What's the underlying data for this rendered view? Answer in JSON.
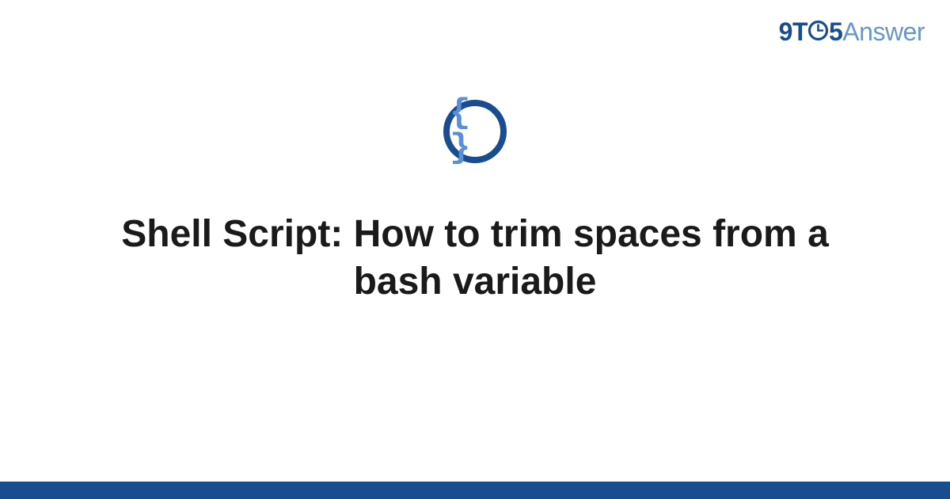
{
  "logo": {
    "nine": "9",
    "t": "T",
    "five": "5",
    "answer": "Answer"
  },
  "icon": {
    "name": "code-braces",
    "glyph": "{ }"
  },
  "title": "Shell Script: How to trim spaces from a bash variable",
  "colors": {
    "primary": "#1a4d8f",
    "secondary": "#6b95c9",
    "icon_inner": "#5a8fd6"
  }
}
